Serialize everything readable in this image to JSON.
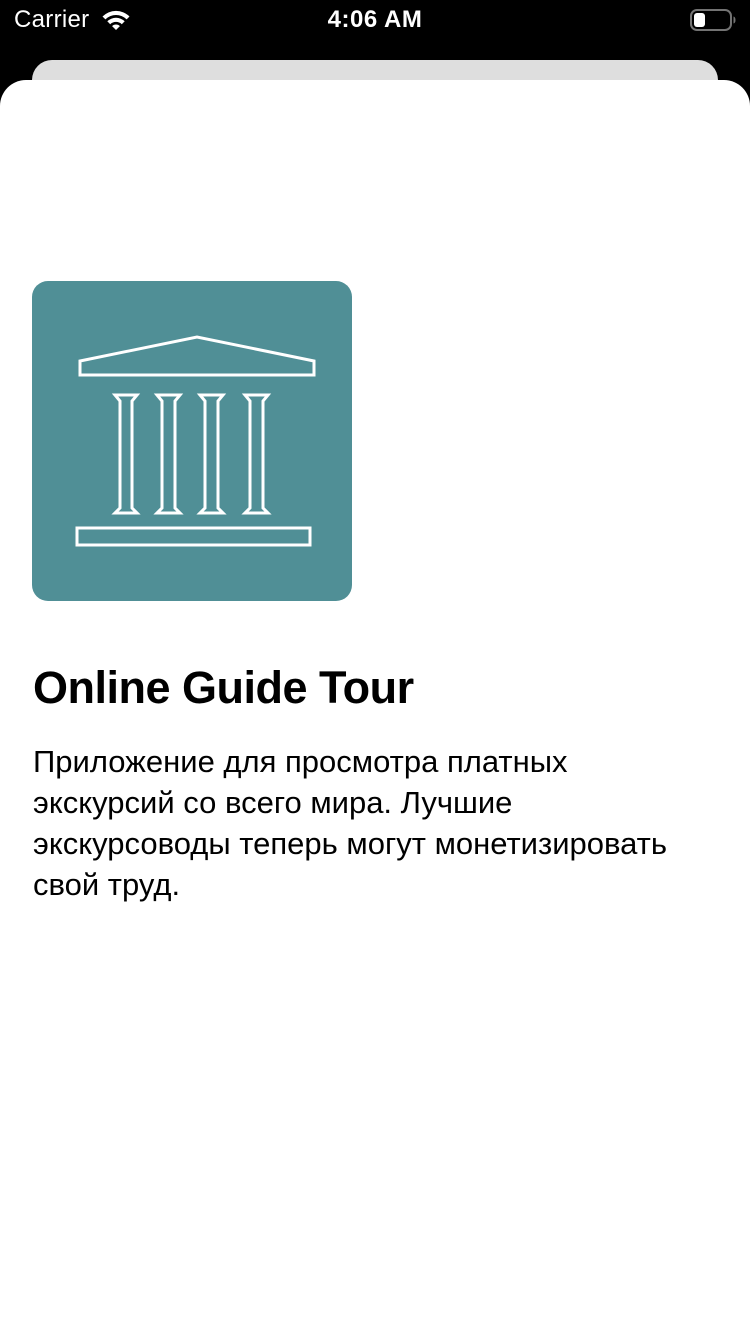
{
  "status_bar": {
    "carrier": "Carrier",
    "time": "4:06 AM",
    "wifi_icon": "wifi-icon",
    "battery_icon": "battery-icon"
  },
  "app": {
    "icon": "museum-columns-icon",
    "icon_color": "#508f96",
    "title": "Online Guide Tour",
    "description": "Приложение для просмотра платных экскурсий со всего мира. Лучшие экскурсоводы теперь могут монетизировать свой труд."
  }
}
